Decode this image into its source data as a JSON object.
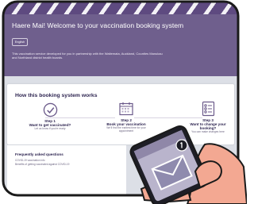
{
  "hero": {
    "title": "Haere Mai! Welcome to your vaccination booking system",
    "language_button": "English",
    "description": "This vaccination service developed for you in partnership with the Waitemata, Auckland, Counties Manukau and Northland district health boards."
  },
  "how_it_works": {
    "title": "How this booking system works",
    "steps": [
      {
        "number": "Step 1",
        "title": "Want to get vaccinated?",
        "description": "Let us know if you're ready",
        "icon": "check-circle-icon"
      },
      {
        "number": "Step 2",
        "title": "Book your vaccination",
        "description": "We'll find the earliest time for your appointment",
        "icon": "calendar-icon"
      },
      {
        "number": "Step 3",
        "title": "Want to change your booking?",
        "description": "You can make changes here",
        "icon": "checklist-icon"
      }
    ]
  },
  "faq": {
    "title": "Frequently asked questions",
    "lines": [
      "COVID-19 vaccination info",
      "Benefits of getting vaccinated against COVID-19"
    ]
  },
  "colors": {
    "header_purple": "#6f5f8d",
    "stripe_purple": "#5e4a80",
    "text_dark": "#2d2450",
    "phone_dark": "#1e1e26",
    "skin": "#f3a892"
  }
}
